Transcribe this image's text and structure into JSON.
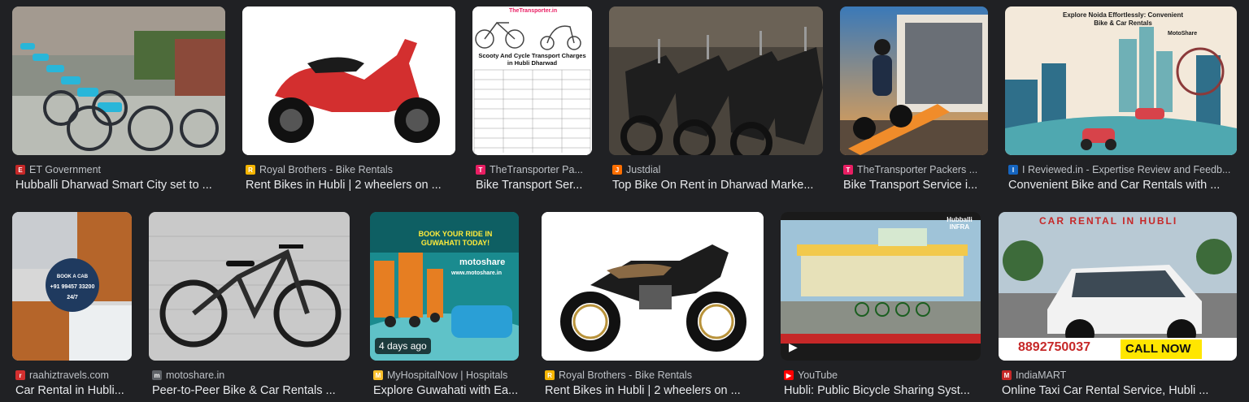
{
  "results": [
    {
      "source": "ET Government",
      "title": "Hubballi Dharwad Smart City set to ...",
      "favicon": "et-icon",
      "favicon_color": "#c62828"
    },
    {
      "source": "Royal Brothers - Bike Rentals",
      "title": "Rent Bikes in Hubli | 2 wheelers on ...",
      "favicon": "royal-brothers-icon",
      "favicon_color": "#f4b400"
    },
    {
      "source": "TheTransporter Pa...",
      "title": "Bike Transport Ser...",
      "favicon": "transporter-icon",
      "favicon_color": "#e91e63",
      "thumb_site": "TheTransporter.in",
      "thumb_heading": "Scooty And Cycle Transport Charges in Hubli Dharwad"
    },
    {
      "source": "Justdial",
      "title": "Top Bike On Rent in Dharwad Marke...",
      "favicon": "justdial-icon",
      "favicon_color": "#ff6f00"
    },
    {
      "source": "TheTransporter Packers ...",
      "title": "Bike Transport Service i...",
      "favicon": "transporter-icon",
      "favicon_color": "#e91e63"
    },
    {
      "source": "I Reviewed.in - Expertise Review and Feedb...",
      "title": "Convenient Bike and Car Rentals with ...",
      "favicon": "ireviewed-icon",
      "favicon_color": "#1565c0",
      "thumb_heading": "Explore Noida Effortlessly: Convenient Bike & Car Rentals",
      "thumb_brand": "MotoShare"
    },
    {
      "source": "raahiztravels.com",
      "title": "Car Rental in Hubli...",
      "favicon": "raahiz-icon",
      "favicon_color": "#d32f2f",
      "thumb_text_a": "BOOK A CAB",
      "thumb_text_b": "+91 99457 33200",
      "thumb_text_c": "24/7"
    },
    {
      "source": "motoshare.in",
      "title": "Peer-to-Peer Bike & Car Rentals ...",
      "favicon": "motoshare-icon",
      "favicon_color": "#5f6368"
    },
    {
      "source": "MyHospitalNow | Hospitals",
      "title": "Explore Guwahati with Ea...",
      "favicon": "myhospitalnow-icon",
      "favicon_color": "#fbc02d",
      "badge": "4 days ago",
      "thumb_heading": "BOOK YOUR RIDE IN GUWAHATI TODAY!",
      "thumb_brand": "motoshare",
      "thumb_url": "www.motoshare.in"
    },
    {
      "source": "Royal Brothers - Bike Rentals",
      "title": "Rent Bikes in Hubli | 2 wheelers on ...",
      "favicon": "royal-brothers-icon",
      "favicon_color": "#f4b400"
    },
    {
      "source": "YouTube",
      "title": "Hubli: Public Bicycle Sharing Syst...",
      "favicon": "youtube-icon",
      "favicon_color": "#ff0000",
      "thumb_brand": "Hubballi INFRA"
    },
    {
      "source": "IndiaMART",
      "title": "Online Taxi Car Rental Service, Hubli ...",
      "favicon": "indiamart-icon",
      "favicon_color": "#c62828",
      "thumb_heading": "CAR RENTAL IN HUBLI",
      "thumb_phone": "8892750037",
      "thumb_cta": "CALL NOW"
    }
  ]
}
